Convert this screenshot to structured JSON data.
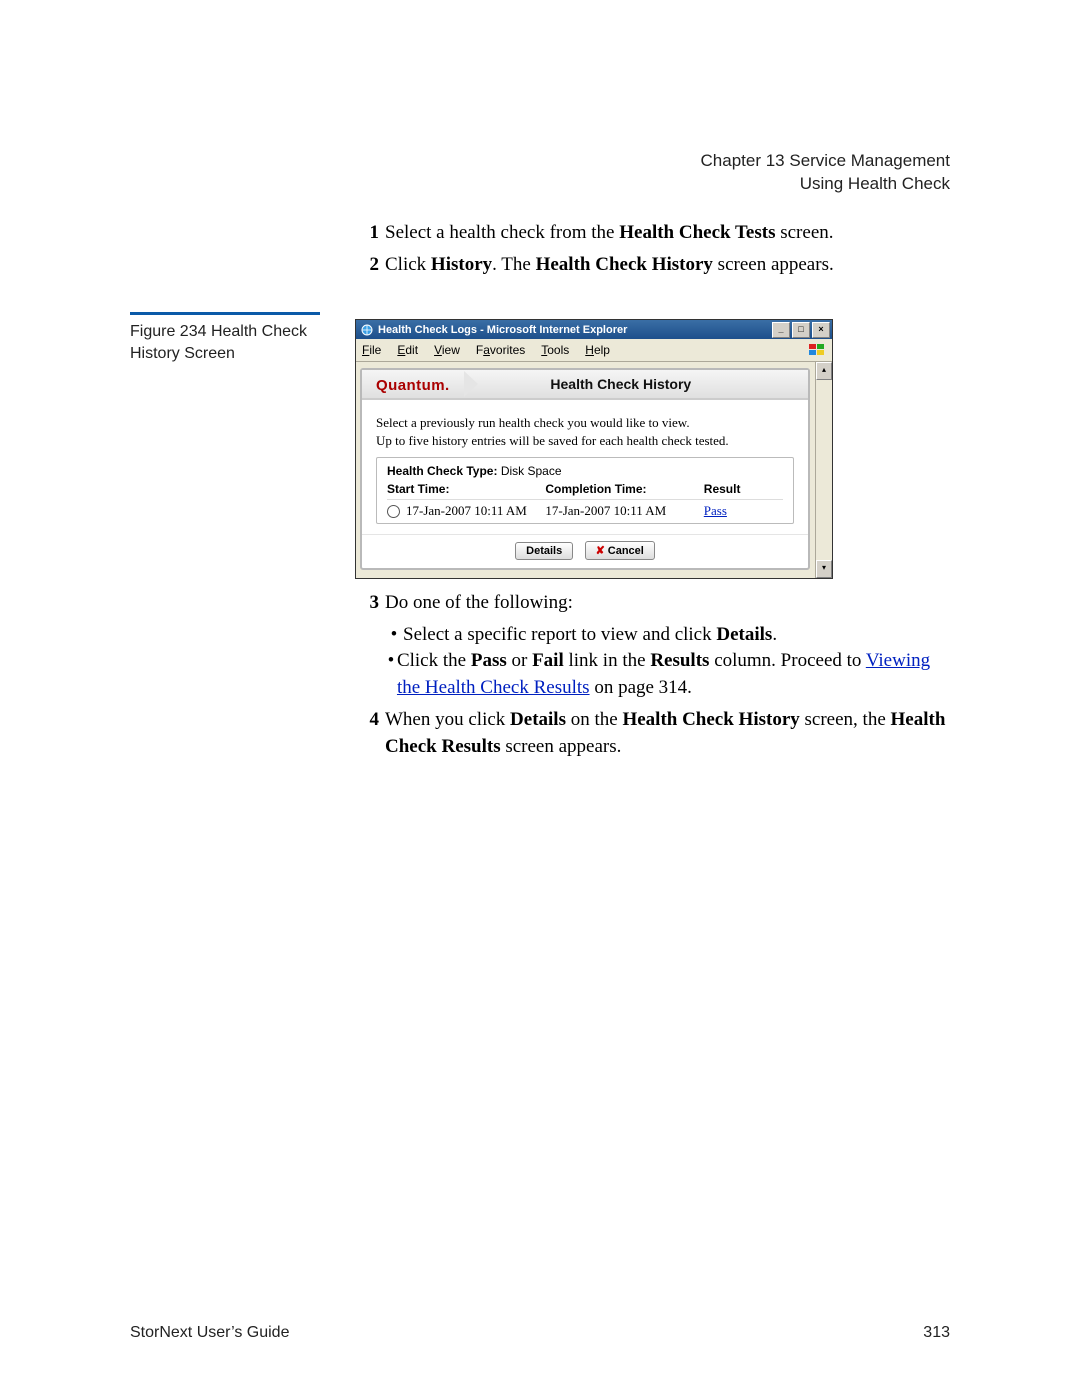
{
  "header": {
    "chapter": "Chapter 13  Service Management",
    "section": "Using Health Check"
  },
  "steps_top": [
    {
      "n": "1",
      "pre": "Select a health check from the ",
      "b1": "Health Check Tests",
      "post": " screen."
    },
    {
      "n": "2",
      "pre": "Click ",
      "b1": "History",
      "mid": ". The ",
      "b2": "Health Check History",
      "post": " screen appears."
    }
  ],
  "figure_label": "Figure 234  Health Check History Screen",
  "ie": {
    "title": "Health Check Logs - Microsoft Internet Explorer",
    "menus": [
      "File",
      "Edit",
      "View",
      "Favorites",
      "Tools",
      "Help"
    ],
    "brand": "Quantum.",
    "panel_title": "Health Check History",
    "desc_line1": "Select a previously run health check you would like to view.",
    "desc_line2": "Up to five history entries will be saved for each health check tested.",
    "type_label": "Health Check Type:",
    "type_value": "Disk Space",
    "col_start": "Start Time:",
    "col_comp": "Completion Time:",
    "col_result": "Result",
    "row": {
      "start": "17-Jan-2007 10:11 AM",
      "comp": "17-Jan-2007 10:11 AM",
      "result": "Pass"
    },
    "btn_details": "Details",
    "btn_cancel": "Cancel",
    "win_min": "_",
    "win_max": "□",
    "win_close": "×",
    "scroll_up": "▴",
    "scroll_down": "▾"
  },
  "steps_bottom": {
    "s3_lead": "Do one of the following:",
    "s3_a_pre": "Select a specific report to view and click ",
    "s3_a_b": "Details",
    "s3_a_post": ".",
    "s3_b_pre": "Click the ",
    "s3_b_b1": "Pass",
    "s3_b_mid1": " or ",
    "s3_b_b2": "Fail",
    "s3_b_mid2": " link in the ",
    "s3_b_b3": "Results",
    "s3_b_mid3": " column. Proceed to ",
    "s3_b_link": "Viewing the Health Check Results",
    "s3_b_post": " on page  314.",
    "s4_pre": "When you click ",
    "s4_b1": "Details",
    "s4_mid1": " on the ",
    "s4_b2": "Health Check History",
    "s4_mid2": " screen, the ",
    "s4_b3": "Health Check Results",
    "s4_post": " screen appears.",
    "n3": "3",
    "n4": "4"
  },
  "footer": {
    "left": "StorNext User’s Guide",
    "right": "313"
  }
}
